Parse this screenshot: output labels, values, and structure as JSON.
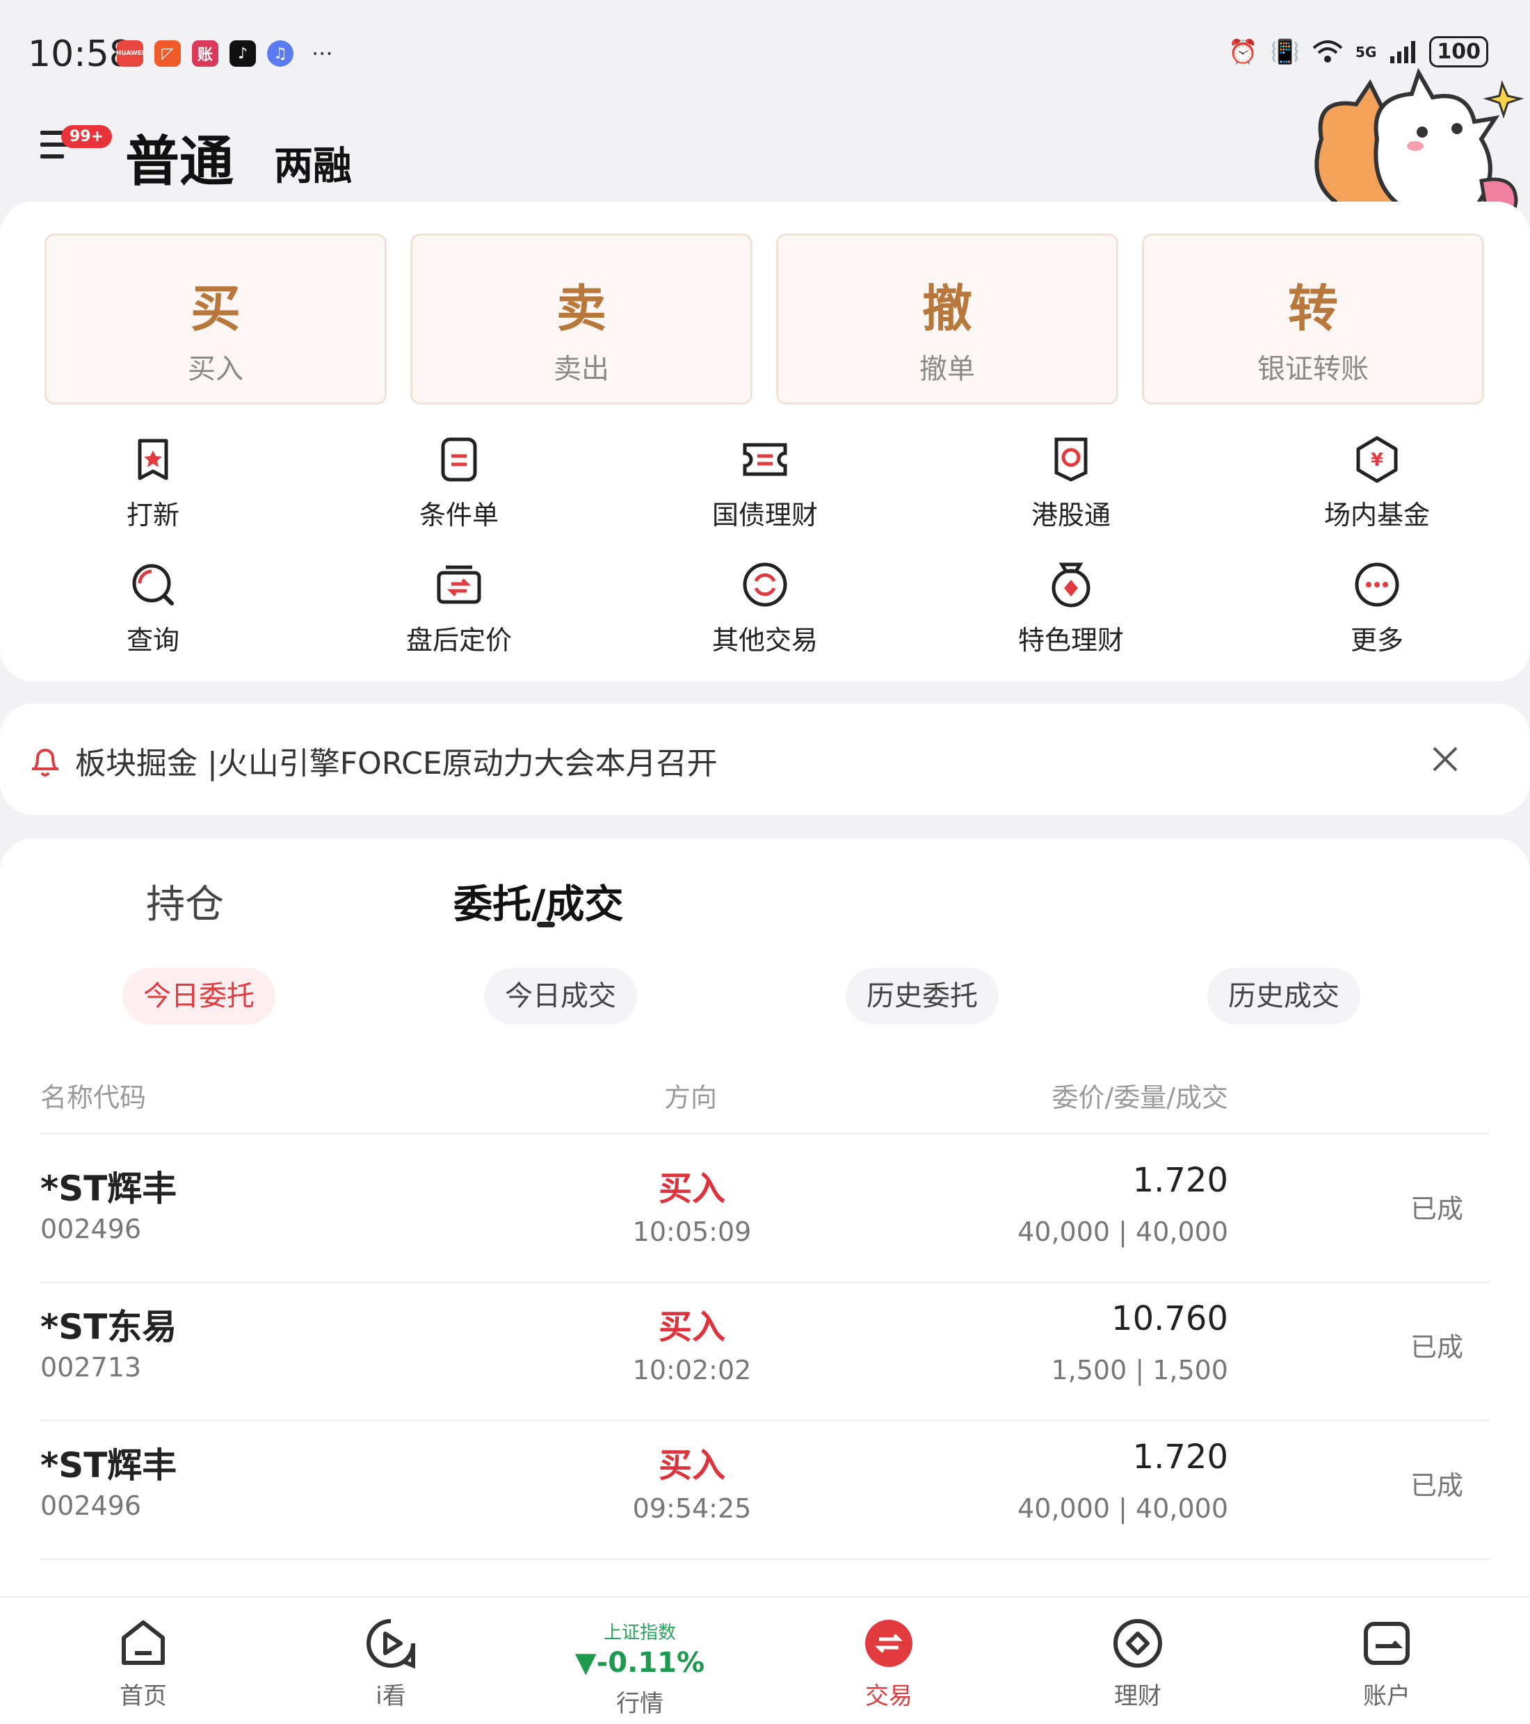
{
  "status_bar": {
    "time": "10:58",
    "notif_badges": [
      "HUAWEI",
      "◸",
      "账",
      "♪",
      "♫"
    ],
    "overflow": "···",
    "network": "5G",
    "battery": "100"
  },
  "header": {
    "badge": "99+",
    "tab_active": "普通",
    "tab_other": "两融"
  },
  "quick_actions": [
    {
      "char": "买",
      "label": "买入"
    },
    {
      "char": "卖",
      "label": "卖出"
    },
    {
      "char": "撤",
      "label": "撤单"
    },
    {
      "char": "转",
      "label": "银证转账"
    }
  ],
  "grid": [
    {
      "label": "打新",
      "icon": "ipo-icon"
    },
    {
      "label": "条件单",
      "icon": "condition-order-icon"
    },
    {
      "label": "国债理财",
      "icon": "bond-icon"
    },
    {
      "label": "港股通",
      "icon": "hk-connect-icon"
    },
    {
      "label": "场内基金",
      "icon": "fund-icon"
    },
    {
      "label": "查询",
      "icon": "query-icon"
    },
    {
      "label": "盘后定价",
      "icon": "after-hours-icon"
    },
    {
      "label": "其他交易",
      "icon": "other-trade-icon"
    },
    {
      "label": "特色理财",
      "icon": "featured-finance-icon"
    },
    {
      "label": "更多",
      "icon": "more-icon"
    }
  ],
  "notice": {
    "text": "板块掘金 |火山引擎FORCE原动力大会本月召开"
  },
  "orders": {
    "tab_positions": "持仓",
    "tab_orders": "委托/成交",
    "filters": [
      "今日委托",
      "今日成交",
      "历史委托",
      "历史成交"
    ],
    "columns": {
      "name": "名称代码",
      "direction": "方向",
      "price": "委价/委量/成交"
    },
    "rows": [
      {
        "name": "*ST辉丰",
        "code": "002496",
        "direction": "买入",
        "time": "10:05:09",
        "price": "1.720",
        "qty": "40,000 | 40,000",
        "status": "已成"
      },
      {
        "name": "*ST东易",
        "code": "002713",
        "direction": "买入",
        "time": "10:02:02",
        "price": "10.760",
        "qty": "1,500 | 1,500",
        "status": "已成"
      },
      {
        "name": "*ST辉丰",
        "code": "002496",
        "direction": "买入",
        "time": "09:54:25",
        "price": "1.720",
        "qty": "40,000 | 40,000",
        "status": "已成"
      }
    ]
  },
  "bottom_nav": {
    "home": "首页",
    "watch": "i看",
    "market_title": "上证指数",
    "market_value": "▼-0.11%",
    "market": "行情",
    "trade": "交易",
    "finance": "理财",
    "account": "账户"
  },
  "colors": {
    "accent_red": "#e13b3f",
    "gold": "#b8783c",
    "green": "#1d9a4e"
  }
}
